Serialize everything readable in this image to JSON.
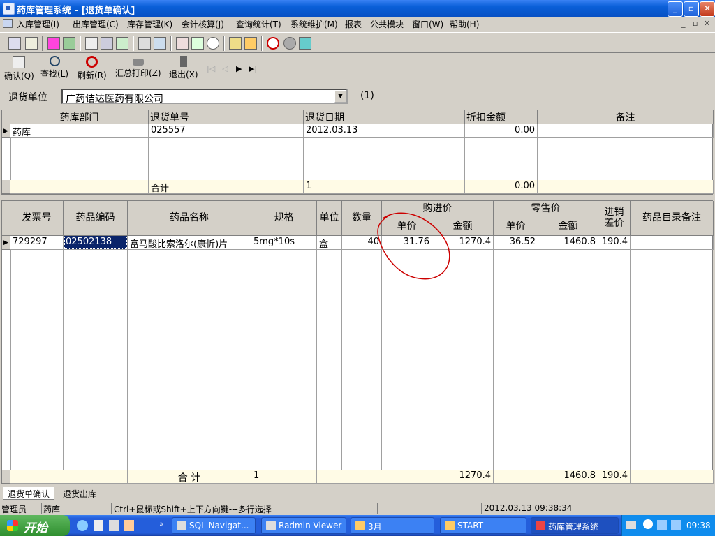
{
  "window": {
    "title": "药库管理系统 - [退货单确认]"
  },
  "menu": [
    "入库管理(I)",
    "出库管理(C)",
    "库存管理(K)",
    "会计核算(J)",
    "查询统计(T)",
    "系统维护(M)",
    "报表",
    "公共模块",
    "窗口(W)",
    "帮助(H)"
  ],
  "actions": {
    "confirm": "确认(Q)",
    "find": "查找(L)",
    "refresh": "刷新(R)",
    "summary_print": "汇总打印(Z)",
    "exit": "退出(X)"
  },
  "nav": {
    "first": "|◁",
    "prev": "◁",
    "next": "▶",
    "last": "▶|"
  },
  "return_unit": {
    "label": "退货单位",
    "value": "广药诘达医药有限公司",
    "count": "(1)"
  },
  "master": {
    "headers": [
      "药库部门",
      "退货单号",
      "退货日期",
      "折扣金额",
      "备注"
    ],
    "row": {
      "dept": "药库",
      "no": "025557",
      "date": "2012.03.13",
      "discount": "0.00",
      "note": ""
    },
    "total": {
      "label": "合计",
      "count": "1",
      "amount": "0.00"
    }
  },
  "detail": {
    "headers": {
      "invoice": "发票号",
      "code": "药品编码",
      "name": "药品名称",
      "spec": "规格",
      "unit": "单位",
      "qty": "数量",
      "purchase": "购进价",
      "retail": "零售价",
      "unit_price": "单价",
      "amount": "金额",
      "diff": "进销差价",
      "remark": "药品目录备注"
    },
    "row": {
      "invoice": "729297",
      "code": "02502138",
      "name": "富马酸比索洛尔(康忻)片",
      "spec": "5mg*10s",
      "unit": "盒",
      "qty": "40",
      "p_price": "31.76",
      "p_amount": "1270.4",
      "r_price": "36.52",
      "r_amount": "1460.8",
      "diff": "190.4",
      "remark": ""
    },
    "total": {
      "label": "合  计",
      "count": "1",
      "p_amount": "1270.4",
      "r_amount": "1460.8",
      "diff": "190.4"
    }
  },
  "tabs": [
    "退货单确认",
    "退货出库"
  ],
  "status": {
    "user": "管理员",
    "dept": "药库",
    "hint": "Ctrl+鼠标或Shift+上下方向键---多行选择",
    "datetime": "2012.03.13 09:38:34"
  },
  "taskbar": {
    "start": "开始",
    "tasks": [
      "SQL Navigat...",
      "Radmin Viewer",
      "3月",
      "START",
      "药库管理系统"
    ],
    "clock": "09:38"
  },
  "colors": {
    "titlebar": "#0a5fd8",
    "annotation": "#cc0000",
    "selected": "#0a246a"
  }
}
